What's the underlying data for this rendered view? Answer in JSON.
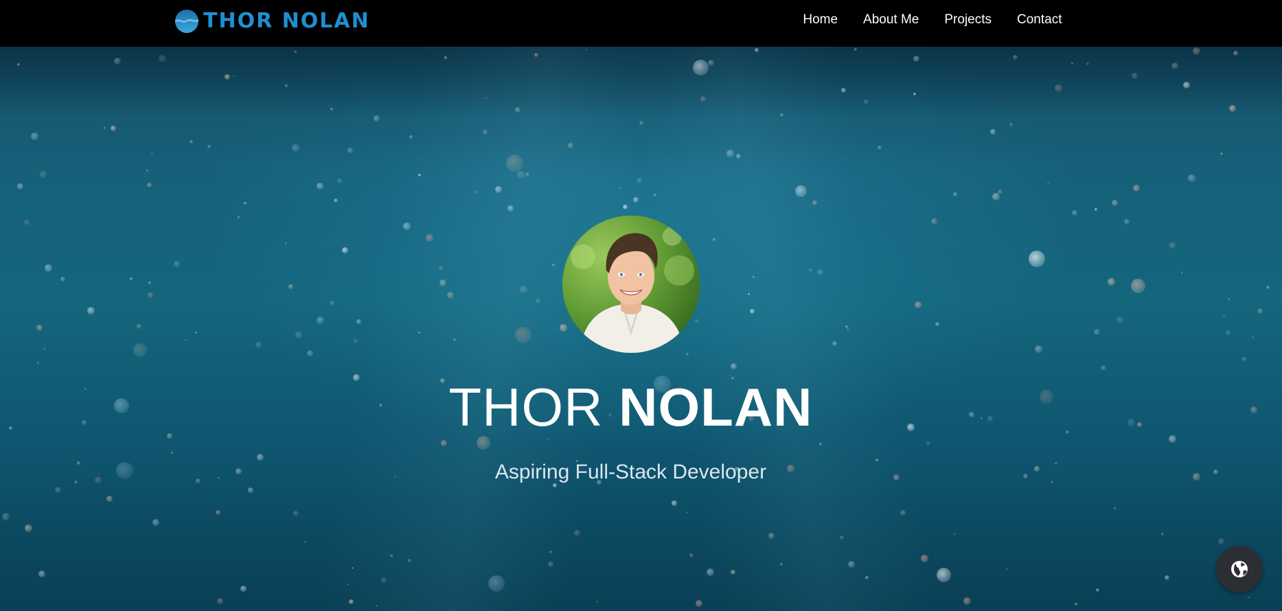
{
  "brand": {
    "name": "THOR NOLAN",
    "icon": "wave-logo-icon",
    "color": "#1f8fd1"
  },
  "nav": {
    "items": [
      {
        "label": "Home"
      },
      {
        "label": "About Me"
      },
      {
        "label": "Projects"
      },
      {
        "label": "Contact"
      }
    ]
  },
  "hero": {
    "first_name": "THOR",
    "last_name": "NOLAN",
    "subtitle": "Aspiring Full-Stack Developer",
    "background": "underwater-bubbles"
  },
  "floating_button": {
    "icon": "globe-icon"
  }
}
